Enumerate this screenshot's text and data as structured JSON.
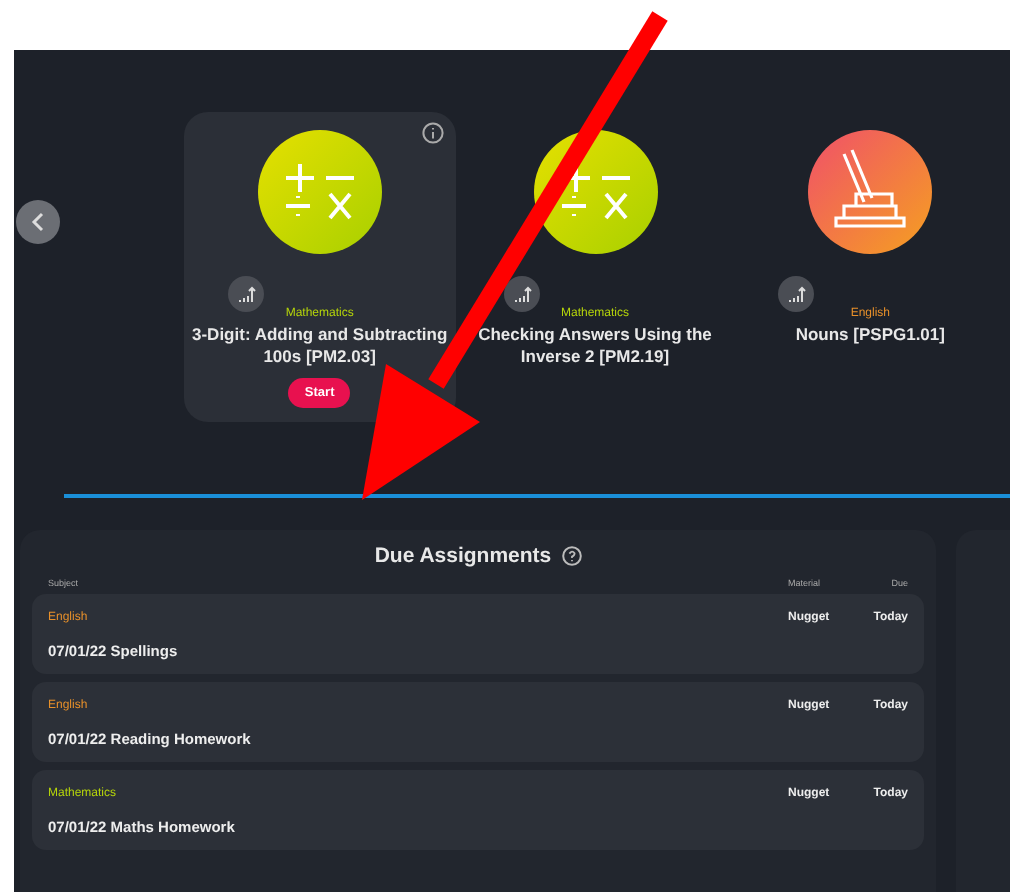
{
  "carousel": {
    "cards": [
      {
        "subject": "Mathematics",
        "color": "#b5d40a",
        "title": [
          "3-Digit: Adding and Subtracting 100s [PM2.03]"
        ],
        "selected": true,
        "kind": "math",
        "button": "Start"
      },
      {
        "subject": "Mathematics",
        "color": "#b5d40a",
        "title": [
          "Checking Answers Using the Inverse 2 [PM2.19]"
        ],
        "selected": false,
        "kind": "math"
      },
      {
        "subject": "English",
        "color": "#e8902a",
        "title": [
          "Nouns [PSPG1.01]"
        ],
        "selected": false,
        "kind": "books"
      }
    ]
  },
  "due": {
    "title": "Due Assignments",
    "columns": [
      "Subject",
      "Material",
      "Due"
    ],
    "rows": [
      {
        "subject": "English",
        "color": "#e8902a",
        "title": "07/01/22 Spellings",
        "material": "Nugget",
        "due": "Today"
      },
      {
        "subject": "English",
        "color": "#e8902a",
        "title": "07/01/22 Reading Homework",
        "material": "Nugget",
        "due": "Today"
      },
      {
        "subject": "Mathematics",
        "color": "#b5d40a",
        "title": "07/01/22 Maths Homework",
        "material": "Nugget",
        "due": "Today"
      }
    ]
  }
}
